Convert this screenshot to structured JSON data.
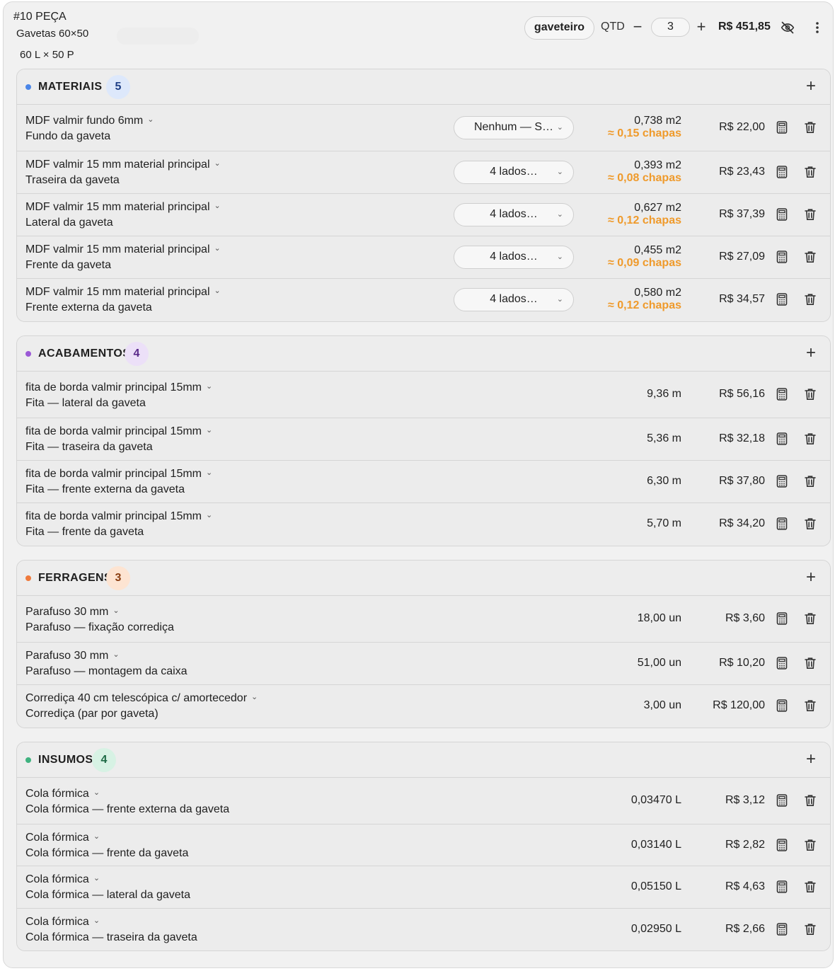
{
  "header": {
    "piece_number": "#10 PEÇA",
    "piece_name": "Gavetas 60×50",
    "dimensions": "60 L × 50 P",
    "tag": "gaveteiro",
    "qtd_label": "QTD",
    "qtd_minus": "−",
    "qtd_value": "3",
    "qtd_plus": "+",
    "total": "R$ 451,85",
    "icons": [
      "eye-off-icon",
      "more-vertical-icon"
    ]
  },
  "sections": [
    {
      "title": "MATERIAIS",
      "count": "5",
      "color": "#4a86e8",
      "count_bg": "#dde8fb",
      "count_color": "#1f3f86",
      "add_label": "+",
      "rows": [
        {
          "name": "MDF valmir fundo 6mm",
          "sub": "Fundo da gaveta",
          "select": "Nenhum — S…",
          "qty": "0,738 m2",
          "chapas": "≈ 0,15 chapas",
          "price": "R$ 22,00"
        },
        {
          "name": "MDF valmir 15 mm material principal",
          "sub": "Traseira da gaveta",
          "select": "4 lados…",
          "qty": "0,393 m2",
          "chapas": "≈ 0,08 chapas",
          "price": "R$ 23,43"
        },
        {
          "name": "MDF valmir 15 mm material principal",
          "sub": "Lateral da gaveta",
          "select": "4 lados…",
          "qty": "0,627 m2",
          "chapas": "≈ 0,12 chapas",
          "price": "R$ 37,39"
        },
        {
          "name": "MDF valmir 15 mm material principal",
          "sub": "Frente da gaveta",
          "select": "4 lados…",
          "qty": "0,455 m2",
          "chapas": "≈ 0,09 chapas",
          "price": "R$ 27,09"
        },
        {
          "name": "MDF valmir 15 mm material principal",
          "sub": "Frente externa da gaveta",
          "select": "4 lados…",
          "qty": "0,580 m2",
          "chapas": "≈ 0,12 chapas",
          "price": "R$ 34,57"
        }
      ]
    },
    {
      "title": "ACABAMENTOS",
      "count": "4",
      "color": "#9b59d6",
      "count_bg": "#ece0f8",
      "count_color": "#5a2a8a",
      "add_label": "+",
      "rows": [
        {
          "name": "fita de borda valmir principal 15mm",
          "sub": "Fita — lateral da gaveta",
          "qty": "9,36 m",
          "price": "R$ 56,16"
        },
        {
          "name": "fita de borda valmir principal 15mm",
          "sub": "Fita — traseira da gaveta",
          "qty": "5,36 m",
          "price": "R$ 32,18"
        },
        {
          "name": "fita de borda valmir principal 15mm",
          "sub": "Fita — frente externa da gaveta",
          "qty": "6,30 m",
          "price": "R$ 37,80"
        },
        {
          "name": "fita de borda valmir principal 15mm",
          "sub": "Fita — frente da gaveta",
          "qty": "5,70 m",
          "price": "R$ 34,20"
        }
      ]
    },
    {
      "title": "FERRAGENS",
      "count": "3",
      "color": "#ef7a3c",
      "count_bg": "#fde4d2",
      "count_color": "#8a3e12",
      "add_label": "+",
      "rows": [
        {
          "name": "Parafuso 30 mm",
          "sub": "Parafuso — fixação corrediça",
          "qty": "18,00 un",
          "price": "R$ 3,60"
        },
        {
          "name": "Parafuso 30 mm",
          "sub": "Parafuso — montagem da caixa",
          "qty": "51,00 un",
          "price": "R$ 10,20"
        },
        {
          "name": "Corrediça 40 cm telescópica c/ amortecedor",
          "sub": "Corrediça (par por gaveta)",
          "qty": "3,00 un",
          "price": "R$ 120,00"
        }
      ]
    },
    {
      "title": "INSUMOS",
      "count": "4",
      "color": "#3fb27f",
      "count_bg": "#d7f2e4",
      "count_color": "#1d6a45",
      "add_label": "+",
      "rows": [
        {
          "name": "Cola fórmica",
          "sub": "Cola fórmica — frente externa da gaveta",
          "qty": "0,03470 L",
          "price": "R$ 3,12"
        },
        {
          "name": "Cola fórmica",
          "sub": "Cola fórmica — frente da gaveta",
          "qty": "0,03140 L",
          "price": "R$ 2,82"
        },
        {
          "name": "Cola fórmica",
          "sub": "Cola fórmica — lateral da gaveta",
          "qty": "0,05150 L",
          "price": "R$ 4,63"
        },
        {
          "name": "Cola fórmica",
          "sub": "Cola fórmica — traseira da gaveta",
          "qty": "0,02950 L",
          "price": "R$ 2,66"
        }
      ]
    }
  ]
}
